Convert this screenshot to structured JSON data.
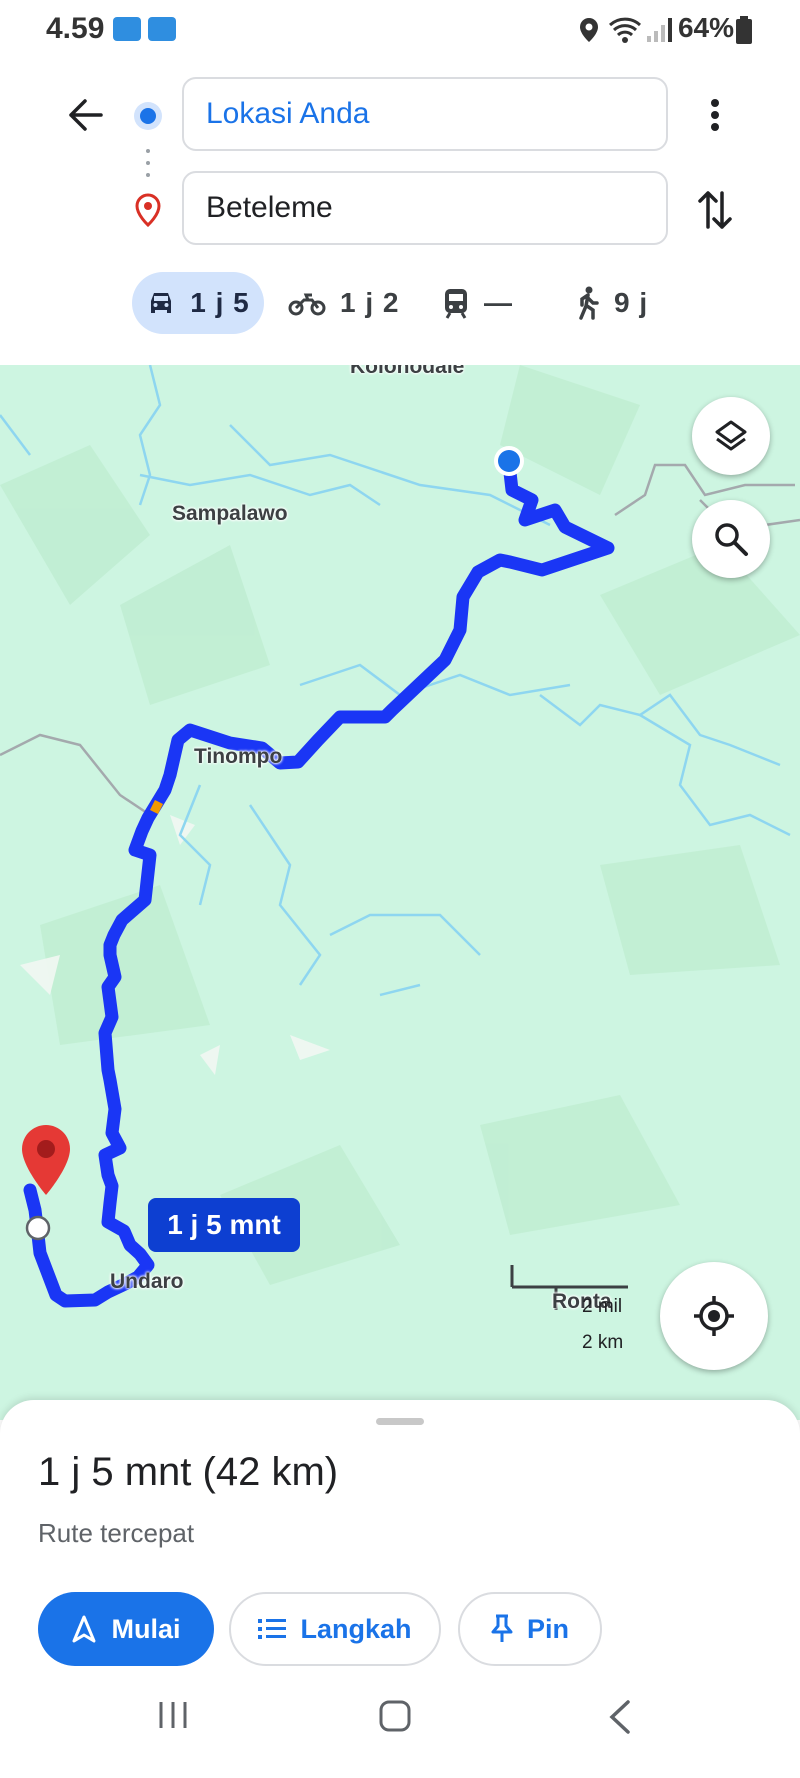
{
  "status_bar": {
    "time": "4.59",
    "battery": "64%"
  },
  "directions": {
    "origin": "Lokasi Anda",
    "destination": "Beteleme"
  },
  "travel_modes": [
    {
      "mode": "car",
      "label": "1 j 5",
      "selected": true
    },
    {
      "mode": "motorcycle",
      "label": "1 j 2",
      "selected": false
    },
    {
      "mode": "transit",
      "label": "—",
      "selected": false
    },
    {
      "mode": "walk",
      "label": "9 j",
      "selected": false
    }
  ],
  "map": {
    "places": [
      "Kolonodale",
      "Sampalawo",
      "Tinompo",
      "Undaro",
      "Ronta"
    ],
    "route_eta_chip": "1 j 5 mnt",
    "scale": {
      "imperial": "2 mil",
      "metric": "2 km"
    },
    "colors": {
      "land": "#cdf5e1",
      "route": "#1a36f5",
      "water": "#8ed6f0",
      "destination_pin": "#e53935",
      "origin_dot": "#1a73e8"
    }
  },
  "sheet": {
    "summary": "1 j 5 mnt (42 km)",
    "description": "Rute tercepat",
    "buttons": {
      "start": "Mulai",
      "steps": "Langkah",
      "pin": "Pin"
    }
  }
}
